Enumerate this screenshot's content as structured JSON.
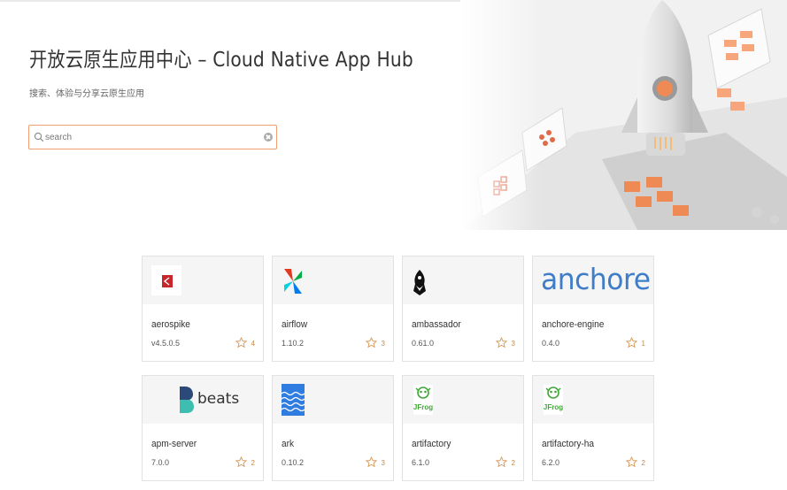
{
  "hero": {
    "title": "开放云原生应用中心 – Cloud Native App Hub",
    "subtitle": "搜索、体验与分享云原生应用",
    "search": {
      "placeholder": "search",
      "value": ""
    }
  },
  "colors": {
    "accent": "#f0a070",
    "star": "#d89a5a"
  },
  "apps": [
    {
      "name": "aerospike",
      "version": "v4.5.0.5",
      "stars": "4",
      "logo": "aerospike-logo"
    },
    {
      "name": "airflow",
      "version": "1.10.2",
      "stars": "3",
      "logo": "airflow-logo"
    },
    {
      "name": "ambassador",
      "version": "0.61.0",
      "stars": "3",
      "logo": "ambassador-logo"
    },
    {
      "name": "anchore-engine",
      "version": "0.4.0",
      "stars": "1",
      "logo": "anchore-logo",
      "logo_text": "anchore"
    },
    {
      "name": "apm-server",
      "version": "7.0.0",
      "stars": "2",
      "logo": "beats-logo",
      "logo_text": "beats"
    },
    {
      "name": "ark",
      "version": "0.10.2",
      "stars": "3",
      "logo": "ark-logo"
    },
    {
      "name": "artifactory",
      "version": "6.1.0",
      "stars": "2",
      "logo": "jfrog-logo",
      "logo_text": "JFrog"
    },
    {
      "name": "artifactory-ha",
      "version": "6.2.0",
      "stars": "2",
      "logo": "jfrog-logo",
      "logo_text": "JFrog"
    }
  ]
}
